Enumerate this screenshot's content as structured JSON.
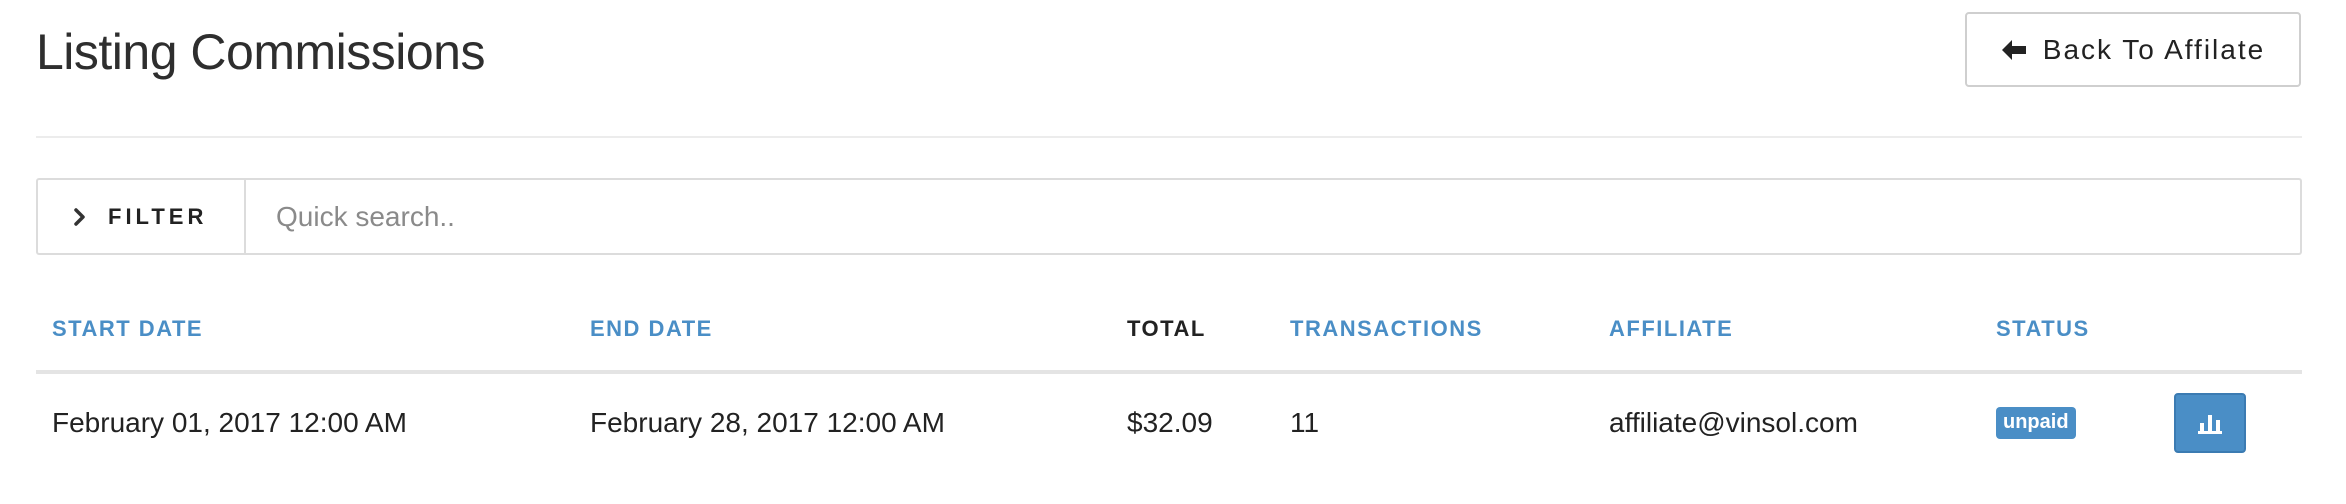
{
  "header": {
    "title": "Listing Commissions",
    "back_button_label": "Back To Affilate"
  },
  "filter": {
    "toggle_label": "FILTER",
    "search_placeholder": "Quick search.."
  },
  "table": {
    "columns": {
      "start_date": "START DATE",
      "end_date": "END DATE",
      "total": "TOTAL",
      "transactions": "TRANSACTIONS",
      "affiliate": "AFFILIATE",
      "status": "STATUS"
    },
    "rows": [
      {
        "start_date": "February 01, 2017 12:00 AM",
        "end_date": "February 28, 2017 12:00 AM",
        "total": "$32.09",
        "transactions": "11",
        "affiliate": "affiliate@vinsol.com",
        "status": "unpaid",
        "action_icon": "bar-chart-icon"
      }
    ]
  },
  "icons": {
    "back": "arrow-left-icon",
    "filter": "chevron-right-icon",
    "stats": "bar-chart-icon"
  },
  "colors": {
    "accent": "#4a8ec6",
    "text": "#222222",
    "border": "#dcdcdc"
  }
}
